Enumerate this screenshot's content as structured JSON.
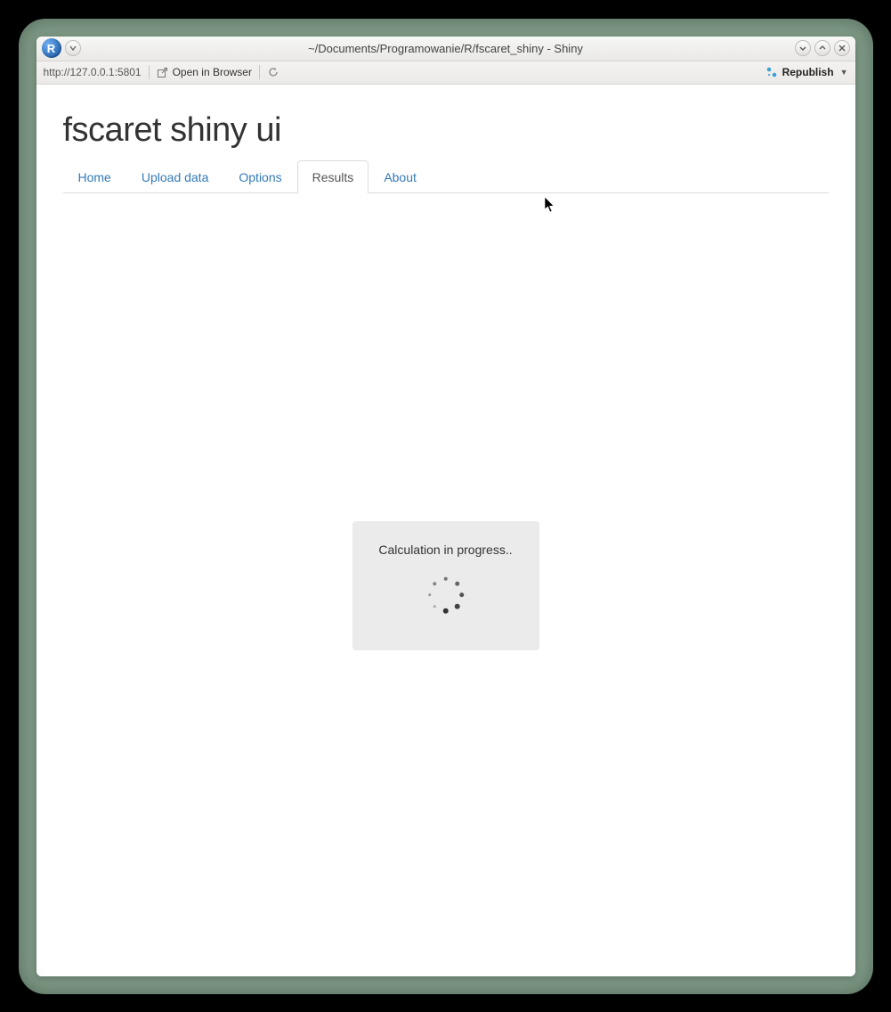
{
  "window": {
    "title": "~/Documents/Programowanie/R/fscaret_shiny - Shiny",
    "app_logo_letter": "R"
  },
  "toolbar": {
    "url": "http://127.0.0.1:5801",
    "open_in_browser_label": "Open in Browser",
    "republish_label": "Republish"
  },
  "page": {
    "title": "fscaret shiny ui"
  },
  "tabs": [
    {
      "label": "Home"
    },
    {
      "label": "Upload data"
    },
    {
      "label": "Options"
    },
    {
      "label": "Results"
    },
    {
      "label": "About"
    }
  ],
  "active_tab_index": 3,
  "loading": {
    "text": "Calculation in progress.."
  }
}
